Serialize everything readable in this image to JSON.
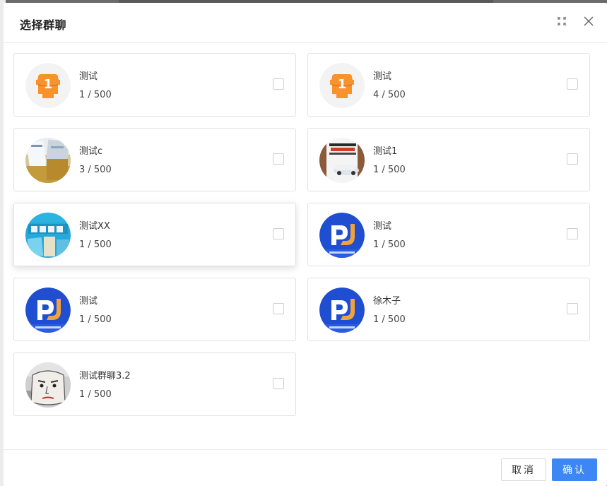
{
  "dialog": {
    "title": "选择群聊"
  },
  "groups": [
    {
      "name": "测试",
      "count": "1 / 500",
      "avatar": "orange-badge-1"
    },
    {
      "name": "测试",
      "count": "4 / 500",
      "avatar": "orange-badge-1"
    },
    {
      "name": "测试c",
      "count": "3 / 500",
      "avatar": "books-photo"
    },
    {
      "name": "测试1",
      "count": "1 / 500",
      "avatar": "car-poster-photo"
    },
    {
      "name": "测试XX",
      "count": "1 / 500",
      "avatar": "blue-poster-photo"
    },
    {
      "name": "测试",
      "count": "1 / 500",
      "avatar": "dj-logo"
    },
    {
      "name": "测试",
      "count": "1 / 500",
      "avatar": "dj-logo"
    },
    {
      "name": "徐木子",
      "count": "1 / 500",
      "avatar": "dj-logo"
    },
    {
      "name": "测试群聊3.2",
      "count": "1 / 500",
      "avatar": "cartoon-face-photo"
    }
  ],
  "footer": {
    "cancel_label": "取消",
    "confirm_label": "确认"
  },
  "colors": {
    "accent": "#3d87f5",
    "orange": "#f7922e",
    "logo_blue": "#1f4fd0"
  }
}
